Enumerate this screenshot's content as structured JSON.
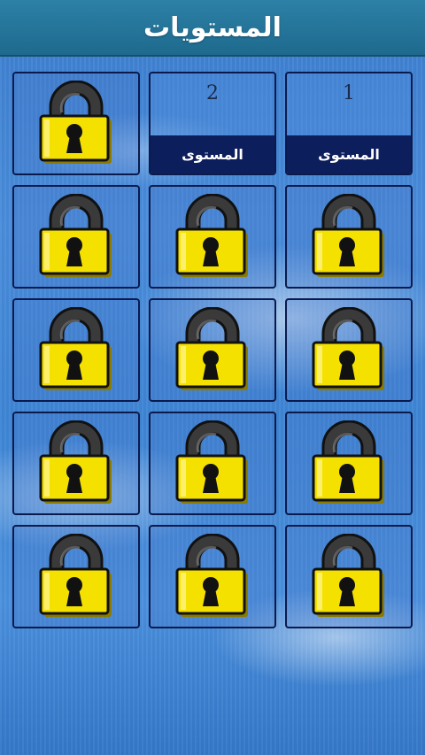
{
  "header": {
    "title": "المستويات"
  },
  "levels": [
    {
      "number": "1",
      "label": "المستوى",
      "state": "unlocked"
    },
    {
      "number": "2",
      "label": "المستوى",
      "state": "unlocked"
    },
    {
      "state": "locked",
      "icon": "padlock-icon"
    },
    {
      "state": "locked",
      "icon": "padlock-icon"
    },
    {
      "state": "locked",
      "icon": "padlock-icon"
    },
    {
      "state": "locked",
      "icon": "padlock-icon"
    },
    {
      "state": "locked",
      "icon": "padlock-icon"
    },
    {
      "state": "locked",
      "icon": "padlock-icon"
    },
    {
      "state": "locked",
      "icon": "padlock-icon"
    },
    {
      "state": "locked",
      "icon": "padlock-icon"
    },
    {
      "state": "locked",
      "icon": "padlock-icon"
    },
    {
      "state": "locked",
      "icon": "padlock-icon"
    },
    {
      "state": "locked",
      "icon": "padlock-icon"
    },
    {
      "state": "locked",
      "icon": "padlock-icon"
    },
    {
      "state": "locked",
      "icon": "padlock-icon"
    }
  ],
  "colors": {
    "header": "#2178a0",
    "tile_border": "#0b1a4d",
    "level_band": "#0d1e5c",
    "lock_body": "#f5e100",
    "lock_shackle": "#3a3a3a"
  }
}
